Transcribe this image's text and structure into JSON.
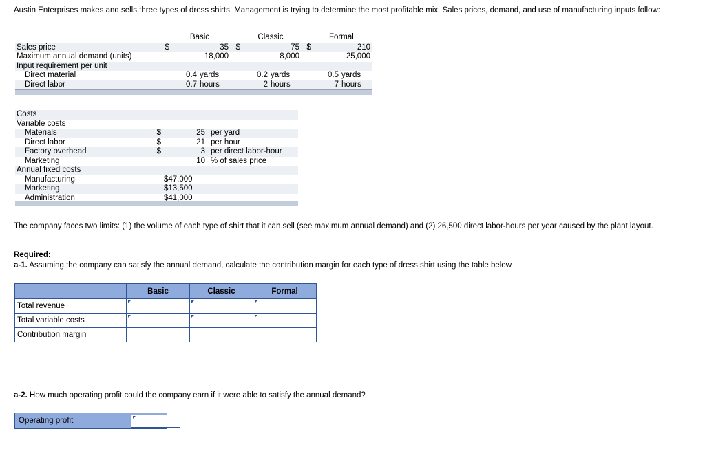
{
  "intro": {
    "text": "Austin Enterprises makes and sells three types of dress shirts. Management is trying to determine the most profitable mix. Sales prices, demand, and use of manufacturing inputs follow:"
  },
  "product_table": {
    "columns": [
      "Basic",
      "Classic",
      "Formal"
    ],
    "rows": [
      {
        "label": "Sales price",
        "basic_symbol": "$",
        "basic": "35",
        "classic_symbol": "$",
        "classic": "75",
        "formal_symbol": "$",
        "formal": "210"
      },
      {
        "label": "Maximum annual demand (units)",
        "basic_symbol": "",
        "basic": "18,000",
        "classic_symbol": "",
        "classic": "8,000",
        "formal_symbol": "",
        "formal": "25,000"
      },
      {
        "label": "Input requirement per unit",
        "basic_symbol": "",
        "basic": "",
        "classic_symbol": "",
        "classic": "",
        "formal_symbol": "",
        "formal": ""
      },
      {
        "label": "Direct material",
        "basic_symbol": "",
        "basic": "0.4",
        "basic_unit": "yards",
        "classic_symbol": "",
        "classic": "0.2",
        "classic_unit": "yards",
        "formal_symbol": "",
        "formal": "0.5",
        "formal_unit": "yards"
      },
      {
        "label": "Direct labor",
        "basic_symbol": "",
        "basic": "0.7",
        "basic_unit": "hours",
        "classic_symbol": "",
        "classic": "2",
        "classic_unit": "hours",
        "formal_symbol": "",
        "formal": "7",
        "formal_unit": "hours"
      }
    ]
  },
  "costs_table": {
    "title": "Costs",
    "variable_heading": "Variable costs",
    "variable_rows": [
      {
        "label": "Materials",
        "symbol": "$",
        "value": "25",
        "text": "per yard"
      },
      {
        "label": "Direct labor",
        "symbol": "$",
        "value": "21",
        "text": "per hour"
      },
      {
        "label": "Factory overhead",
        "symbol": "$",
        "value": "3",
        "text": "per direct labor-hour"
      },
      {
        "label": "Marketing",
        "symbol": "",
        "value": "10",
        "text": "% of sales price"
      }
    ],
    "fixed_heading": "Annual fixed costs",
    "fixed_rows": [
      {
        "label": "Manufacturing",
        "value": "$47,000"
      },
      {
        "label": "Marketing",
        "value": "$13,500"
      },
      {
        "label": "Administration",
        "value": "$41,000"
      }
    ]
  },
  "limits_paragraph": "The company faces two limits: (1) the volume of each type of shirt that it can sell (see maximum annual demand) and (2) 26,500 direct labor-hours per year caused by the plant layout.",
  "required_heading": "Required:",
  "question_a1": "a-1. Assuming the company can satisfy the annual demand, calculate the contribution margin for each type of dress shirt using the table below",
  "question_a1_prefix": "a-1.",
  "question_a1_text": " Assuming the company can satisfy the annual demand, calculate the contribution margin for each type of dress shirt using the table below",
  "answer_table": {
    "corner": "",
    "columns": [
      "Basic",
      "Classic",
      "Formal"
    ],
    "rows": [
      {
        "label": "Total revenue",
        "basic": "",
        "classic": "",
        "formal": ""
      },
      {
        "label": "Total variable costs",
        "basic": "",
        "classic": "",
        "formal": ""
      },
      {
        "label": "Contribution margin",
        "basic": "",
        "classic": "",
        "formal": ""
      }
    ]
  },
  "question_a2_prefix": "a-2.",
  "question_a2_text": " How much operating profit could the company earn if it were able to satisfy the annual demand?",
  "operating_profit": {
    "label": "Operating profit",
    "value": ""
  },
  "colors": {
    "header_blue": "#8faadc",
    "border_blue": "#2f5597",
    "row_shade": "#eceff3",
    "bar_blue": "#c3ccdb"
  }
}
